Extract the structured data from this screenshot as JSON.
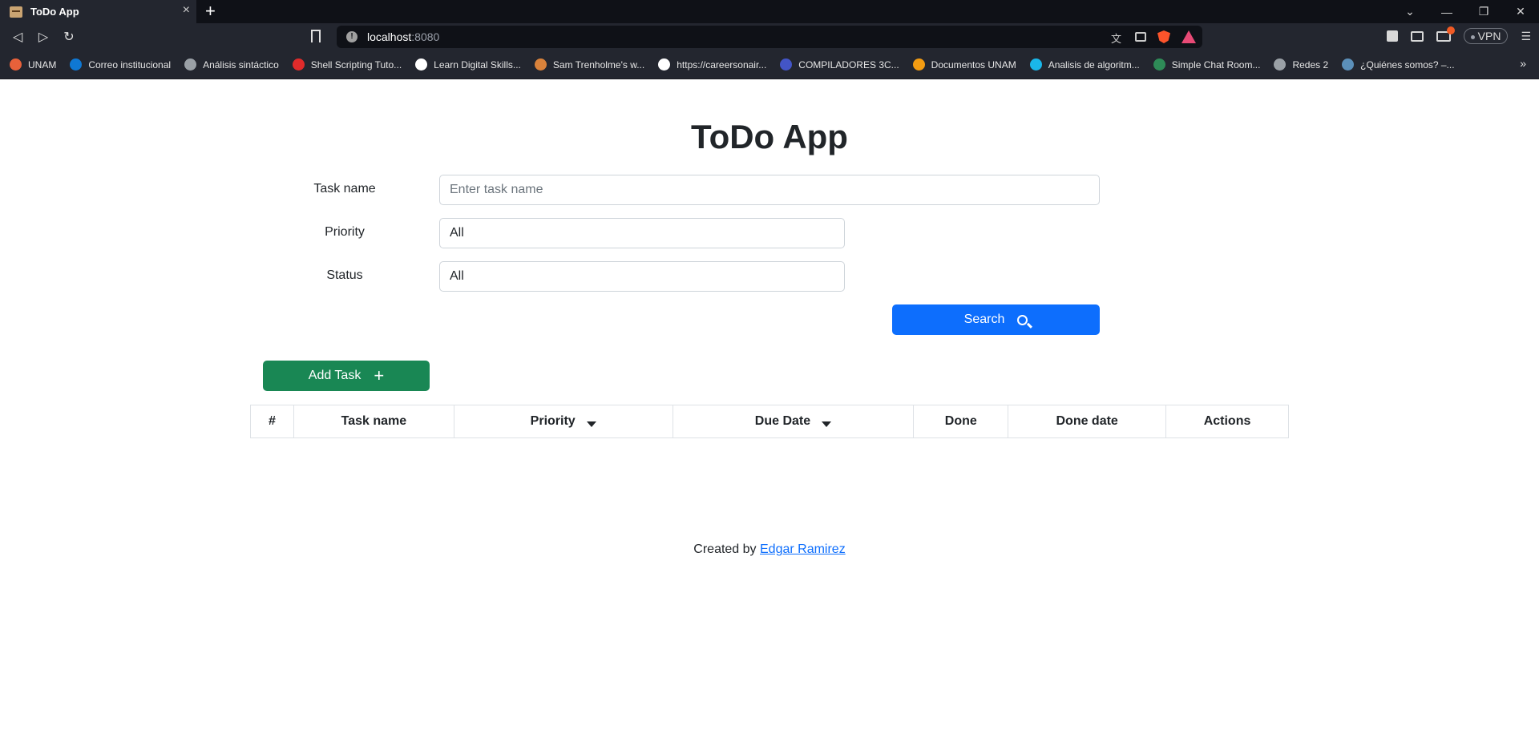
{
  "browser": {
    "tab_title": "ToDo App",
    "tab_close": "×",
    "new_tab": "+",
    "url_host": "localhost",
    "url_port": ":8080",
    "vpn_label": "VPN",
    "bookmarks": [
      {
        "label": "UNAM",
        "color": "#e8613a"
      },
      {
        "label": "Correo institucional",
        "color": "#0f78d4"
      },
      {
        "label": "Análisis sintáctico",
        "color": "#9aa0a6"
      },
      {
        "label": "Shell Scripting Tuto...",
        "color": "#e02b2b"
      },
      {
        "label": "Learn Digital Skills...",
        "color": "#ffffff"
      },
      {
        "label": "Sam Trenholme's w...",
        "color": "#d9823b"
      },
      {
        "label": "https://careersonair...",
        "color": "#ffffff"
      },
      {
        "label": "COMPILADORES 3C...",
        "color": "#4355c7"
      },
      {
        "label": "Documentos UNAM",
        "color": "#f39c12"
      },
      {
        "label": "Analisis de algoritm...",
        "color": "#1ab7ea"
      },
      {
        "label": "Simple Chat Room...",
        "color": "#2e8b57"
      },
      {
        "label": "Redes 2",
        "color": "#9aa0a6"
      },
      {
        "label": "¿Quiénes somos? –...",
        "color": "#5b8fb9"
      }
    ],
    "bookmarks_more": "»"
  },
  "app": {
    "title": "ToDo App",
    "form": {
      "task_name_label": "Task name",
      "task_name_placeholder": "Enter task name",
      "priority_label": "Priority",
      "priority_value": "All",
      "status_label": "Status",
      "status_value": "All",
      "search_label": "Search"
    },
    "add_task_label": "Add Task",
    "table": {
      "headers": [
        "#",
        "Task name",
        "Priority",
        "Due Date",
        "Done",
        "Done date",
        "Actions"
      ]
    },
    "footer": {
      "prefix": "Created by",
      "author": "Edgar Ramirez"
    }
  },
  "colors": {
    "primary": "#0d6efd",
    "success": "#198754",
    "text": "#212529"
  }
}
